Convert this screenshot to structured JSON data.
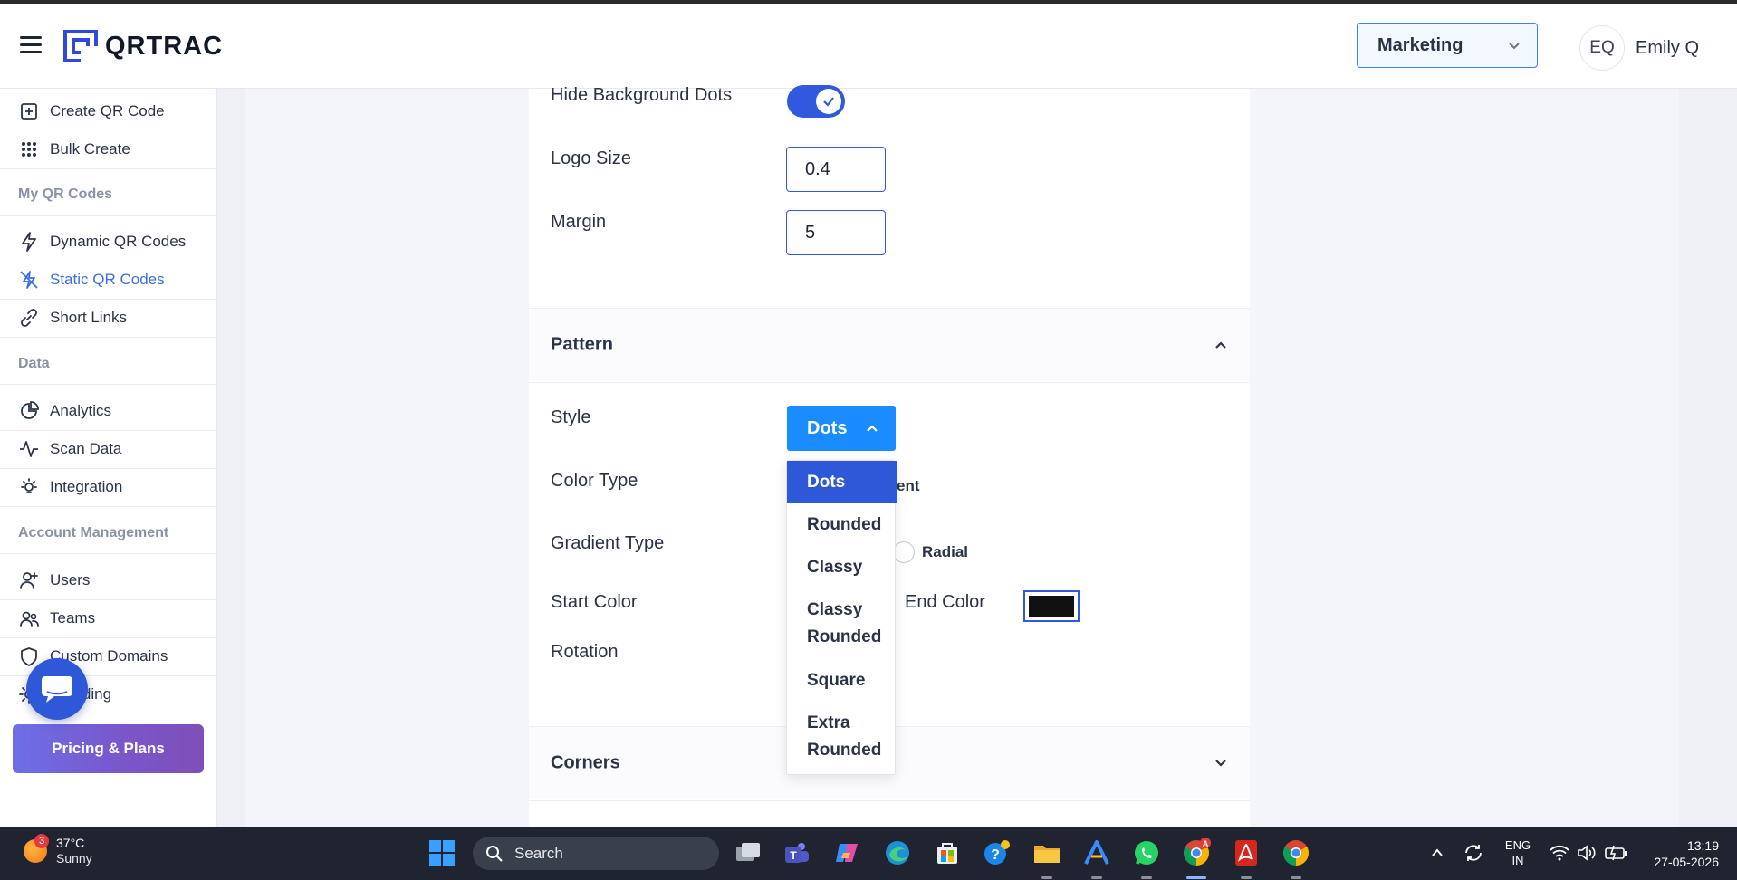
{
  "app": {
    "logo_text": "QRTRAC",
    "org_selector": "Marketing",
    "user": {
      "initials": "EQ",
      "name": "Emily Q"
    }
  },
  "sidebar": {
    "items_top": [
      {
        "label": "Create QR Code",
        "icon": "plus-square-icon"
      },
      {
        "label": "Bulk Create",
        "icon": "grid-dots-icon"
      }
    ],
    "section_my_qr": "My QR Codes",
    "items_my_qr": [
      {
        "label": "Dynamic QR Codes",
        "icon": "lightning-icon"
      },
      {
        "label": "Static QR Codes",
        "icon": "lightning-off-icon",
        "active": true
      },
      {
        "label": "Short Links",
        "icon": "link-icon"
      }
    ],
    "section_data": "Data",
    "items_data": [
      {
        "label": "Analytics",
        "icon": "pie-chart-icon"
      },
      {
        "label": "Scan Data",
        "icon": "activity-icon"
      },
      {
        "label": "Integration",
        "icon": "bulb-icon"
      }
    ],
    "section_account": "Account Management",
    "items_account": [
      {
        "label": "Users",
        "icon": "user-plus-icon"
      },
      {
        "label": "Teams",
        "icon": "team-icon"
      },
      {
        "label": "Custom Domains",
        "icon": "shield-icon"
      },
      {
        "label": "Branding",
        "icon": "sun-icon"
      }
    ],
    "pricing_label": "Pricing & Plans"
  },
  "editor": {
    "hide_bg_dots": {
      "label": "Hide Background Dots",
      "checked": true
    },
    "logo_size": {
      "label": "Logo Size",
      "value": "0.4"
    },
    "margin": {
      "label": "Margin",
      "value": "5"
    },
    "pattern": {
      "title": "Pattern",
      "expanded": true,
      "style_label": "Style",
      "style_value": "Dots",
      "color_type_label": "Color Type",
      "color_type_partial": "ent",
      "gradient_type_label": "Gradient Type",
      "gradient_radial_label": "Radial",
      "start_color_label": "Start Color",
      "end_color_label": "End Color",
      "end_color_value": "#111111",
      "rotation_label": "Rotation"
    },
    "style_options": [
      "Dots",
      "Rounded",
      "Classy",
      "Classy Rounded",
      "Square",
      "Extra Rounded"
    ],
    "style_options_display": [
      {
        "lines": [
          "Dots"
        ],
        "selected": true
      },
      {
        "lines": [
          "Rounded"
        ]
      },
      {
        "lines": [
          "Classy"
        ]
      },
      {
        "lines": [
          "Classy",
          "Rounded"
        ]
      },
      {
        "lines": [
          "Square"
        ]
      },
      {
        "lines": [
          "Extra",
          "Rounded"
        ]
      }
    ],
    "corners": {
      "title": "Corners",
      "expanded": false
    }
  },
  "taskbar": {
    "weather": {
      "temp": "37°C",
      "condition": "Sunny",
      "badge": "3"
    },
    "search_label": "Search",
    "language": {
      "line1": "ENG",
      "line2": "IN"
    },
    "time": "13:19",
    "date": "27-05-2026",
    "chrome_badge": "A"
  },
  "colors": {
    "accent": "#3258dd",
    "style_button": "#1a8cff",
    "pricing_gradient_start": "#6d6fe8",
    "pricing_gradient_end": "#7e4fb8"
  }
}
